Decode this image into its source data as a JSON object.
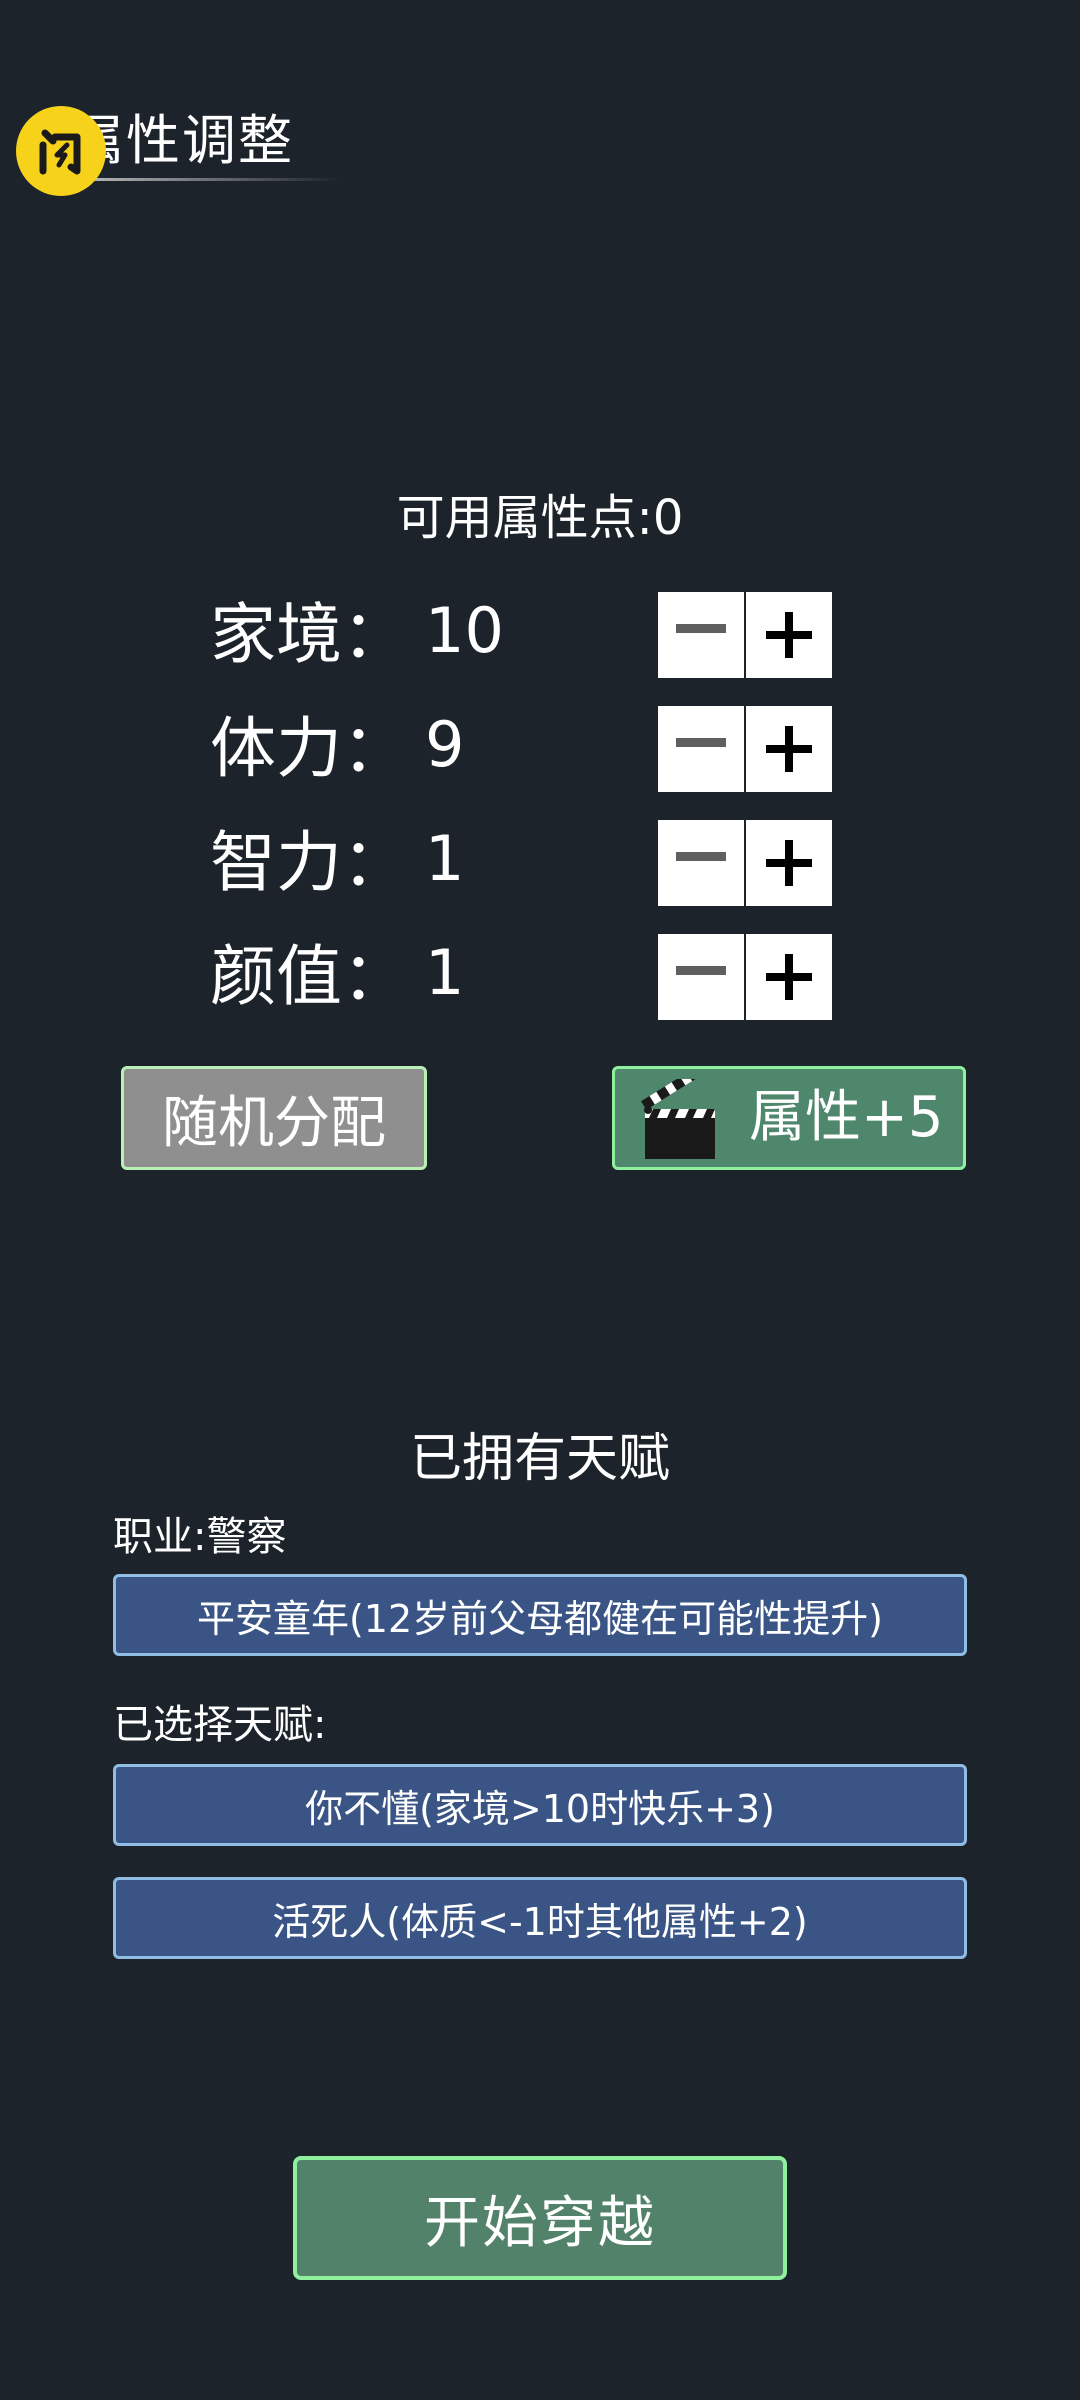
{
  "header": {
    "title": "属性调整"
  },
  "points": {
    "text": "可用属性点:0"
  },
  "attributes": [
    {
      "label": "家境：",
      "value": "10"
    },
    {
      "label": "体力：",
      "value": "9"
    },
    {
      "label": "智力：",
      "value": "1"
    },
    {
      "label": "颜值：",
      "value": "1"
    }
  ],
  "actions": {
    "random_label": "随机分配",
    "bonus_label": "属性+5"
  },
  "talents": {
    "section_title": "已拥有天赋",
    "job": "职业:警察",
    "owned": [
      "平安童年(12岁前父母都健在可能性提升)"
    ],
    "selected_label": "已选择天赋:",
    "selected": [
      "你不懂(家境>10时快乐+3)",
      "活死人(体质<-1时其他属性+2)"
    ]
  },
  "start_label": "开始穿越",
  "icons": {
    "logo": "app-logo-icon",
    "bonus": "clapperboard-icon",
    "minus": "minus-icon",
    "plus": "plus-icon"
  },
  "colors": {
    "background": "#1c232b",
    "gray_button": "#8f8f8f",
    "green_button": "#4e876b",
    "talent_card": "#3a5585",
    "logo_yellow": "#f6d21b"
  }
}
